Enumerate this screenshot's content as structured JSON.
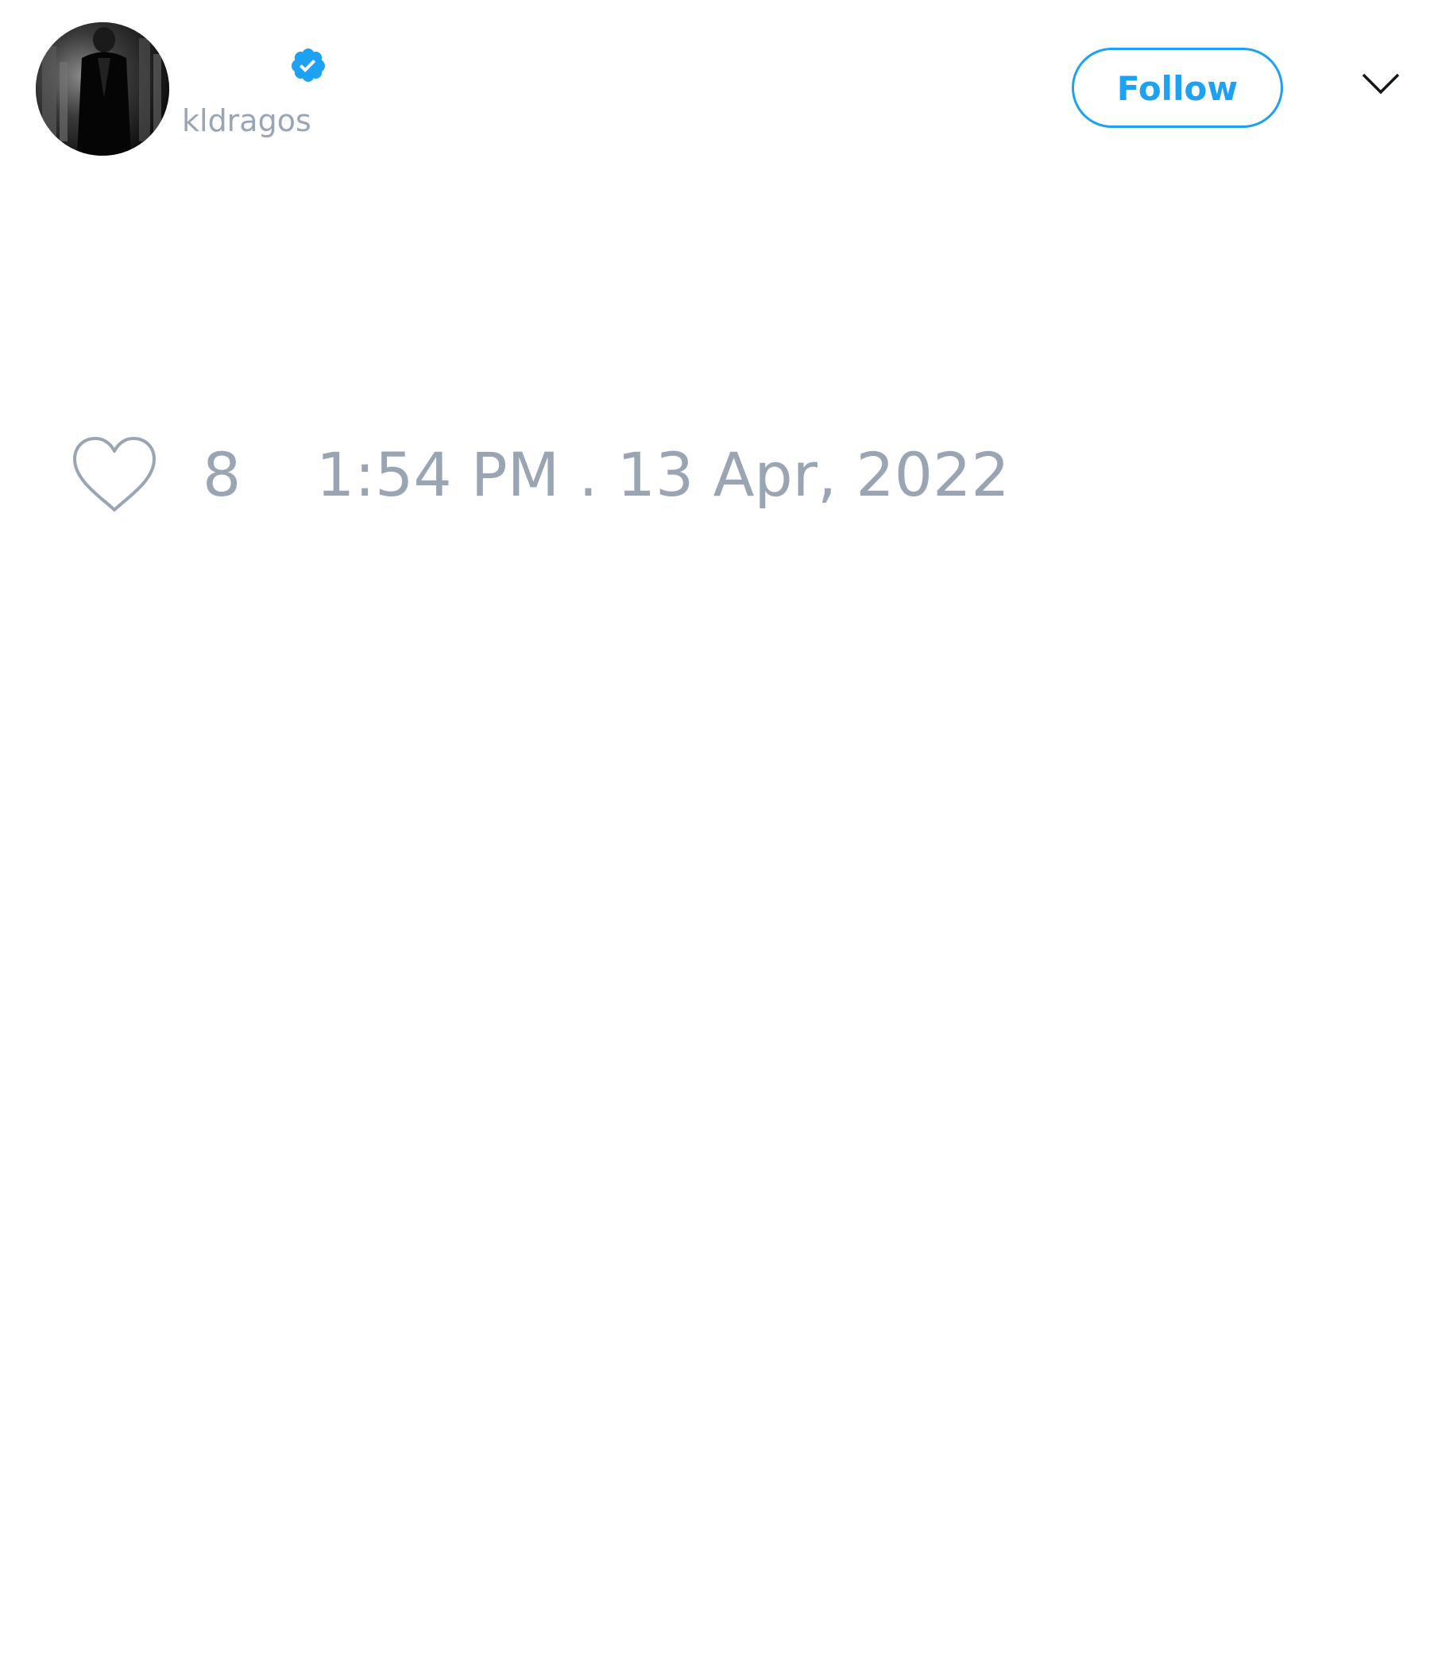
{
  "author": {
    "display_name": "",
    "handle": "kldragos",
    "verified": true
  },
  "header": {
    "follow_label": "Follow"
  },
  "footer": {
    "like_count": "8",
    "timestamp": "1:54 PM . 13 Apr, 2022"
  },
  "icons": {
    "verified": "verified-badge-icon",
    "menu": "chevron-down-icon",
    "like": "heart-icon"
  },
  "colors": {
    "accent": "#1da1f2",
    "muted_text": "#9aa5b4",
    "background": "#ffffff"
  }
}
